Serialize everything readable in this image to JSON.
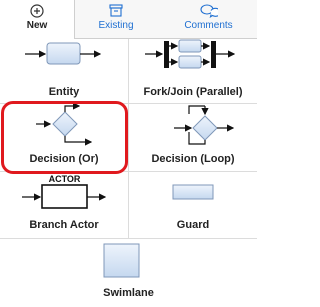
{
  "tabs": [
    {
      "label": "New",
      "icon": "plus-circle-icon",
      "active": true
    },
    {
      "label": "Existing",
      "icon": "archive-box-icon",
      "active": false
    },
    {
      "label": "Comments",
      "icon": "chat-bubbles-icon",
      "active": false
    }
  ],
  "shapes": [
    {
      "label": "Entity",
      "icon": "entity-shape-icon",
      "selected": false
    },
    {
      "label": "Fork/Join (Parallel)",
      "icon": "fork-join-shape-icon",
      "selected": false
    },
    {
      "label": "Decision (Or)",
      "icon": "decision-or-shape-icon",
      "selected": true
    },
    {
      "label": "Decision (Loop)",
      "icon": "decision-loop-shape-icon",
      "selected": false
    },
    {
      "label": "Branch Actor",
      "icon": "branch-actor-shape-icon",
      "actor_caption": "ACTOR",
      "selected": false
    },
    {
      "label": "Guard",
      "icon": "guard-shape-icon",
      "selected": false
    },
    {
      "label": "Swimlane",
      "icon": "swimlane-shape-icon",
      "selected": false
    }
  ],
  "colors": {
    "accent": "#1f6fd1",
    "highlight": "#e0191e",
    "shape_fill_top": "#e9f1fb",
    "shape_fill_bottom": "#c5d8ef",
    "shape_stroke": "#7f97b8"
  }
}
